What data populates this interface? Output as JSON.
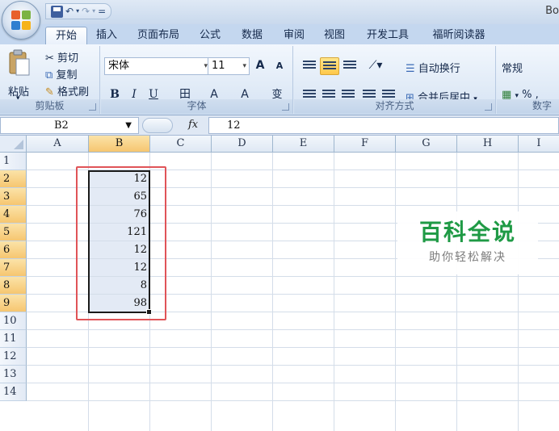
{
  "window": {
    "title": "Bo"
  },
  "qat": {
    "undo": "↶",
    "redo": "↷",
    "customize": "="
  },
  "tabs": [
    "开始",
    "插入",
    "页面布局",
    "公式",
    "数据",
    "审阅",
    "视图",
    "开发工具",
    "福昕阅读器"
  ],
  "ribbon": {
    "clipboard": {
      "paste": "粘贴",
      "cut": "剪切",
      "copy": "复制",
      "format_painter": "格式刷",
      "label": "剪贴板"
    },
    "font": {
      "name": "宋体",
      "size": "11",
      "grow": "A",
      "shrink": "A",
      "bold": "B",
      "italic": "I",
      "underline": "U",
      "border": "田",
      "fill": "A",
      "color": "A",
      "phonetic": "变",
      "label": "字体"
    },
    "alignment": {
      "wrap": "自动换行",
      "merge": "合并后居中",
      "label": "对齐方式"
    },
    "number": {
      "format": "常规",
      "percent": "%",
      "comma": ",",
      "label": "数字"
    }
  },
  "formula_bar": {
    "name_box": "B2",
    "fx": "fx",
    "value": "12"
  },
  "columns": [
    "A",
    "B",
    "C",
    "D",
    "E",
    "F",
    "G",
    "H",
    "I"
  ],
  "rows": [
    "1",
    "2",
    "3",
    "4",
    "5",
    "6",
    "7",
    "8",
    "9",
    "10",
    "11",
    "12",
    "13",
    "14"
  ],
  "cells_b": [
    "12",
    "65",
    "76",
    "121",
    "12",
    "12",
    "8",
    "98"
  ],
  "watermark": {
    "title": "百科全说",
    "subtitle": "助你轻松解决"
  },
  "colors": {
    "highlight_box": "#e05458",
    "selection_fill": "#e3eaf5",
    "header_selected": "#f6c670",
    "watermark": "#1f9a45"
  }
}
